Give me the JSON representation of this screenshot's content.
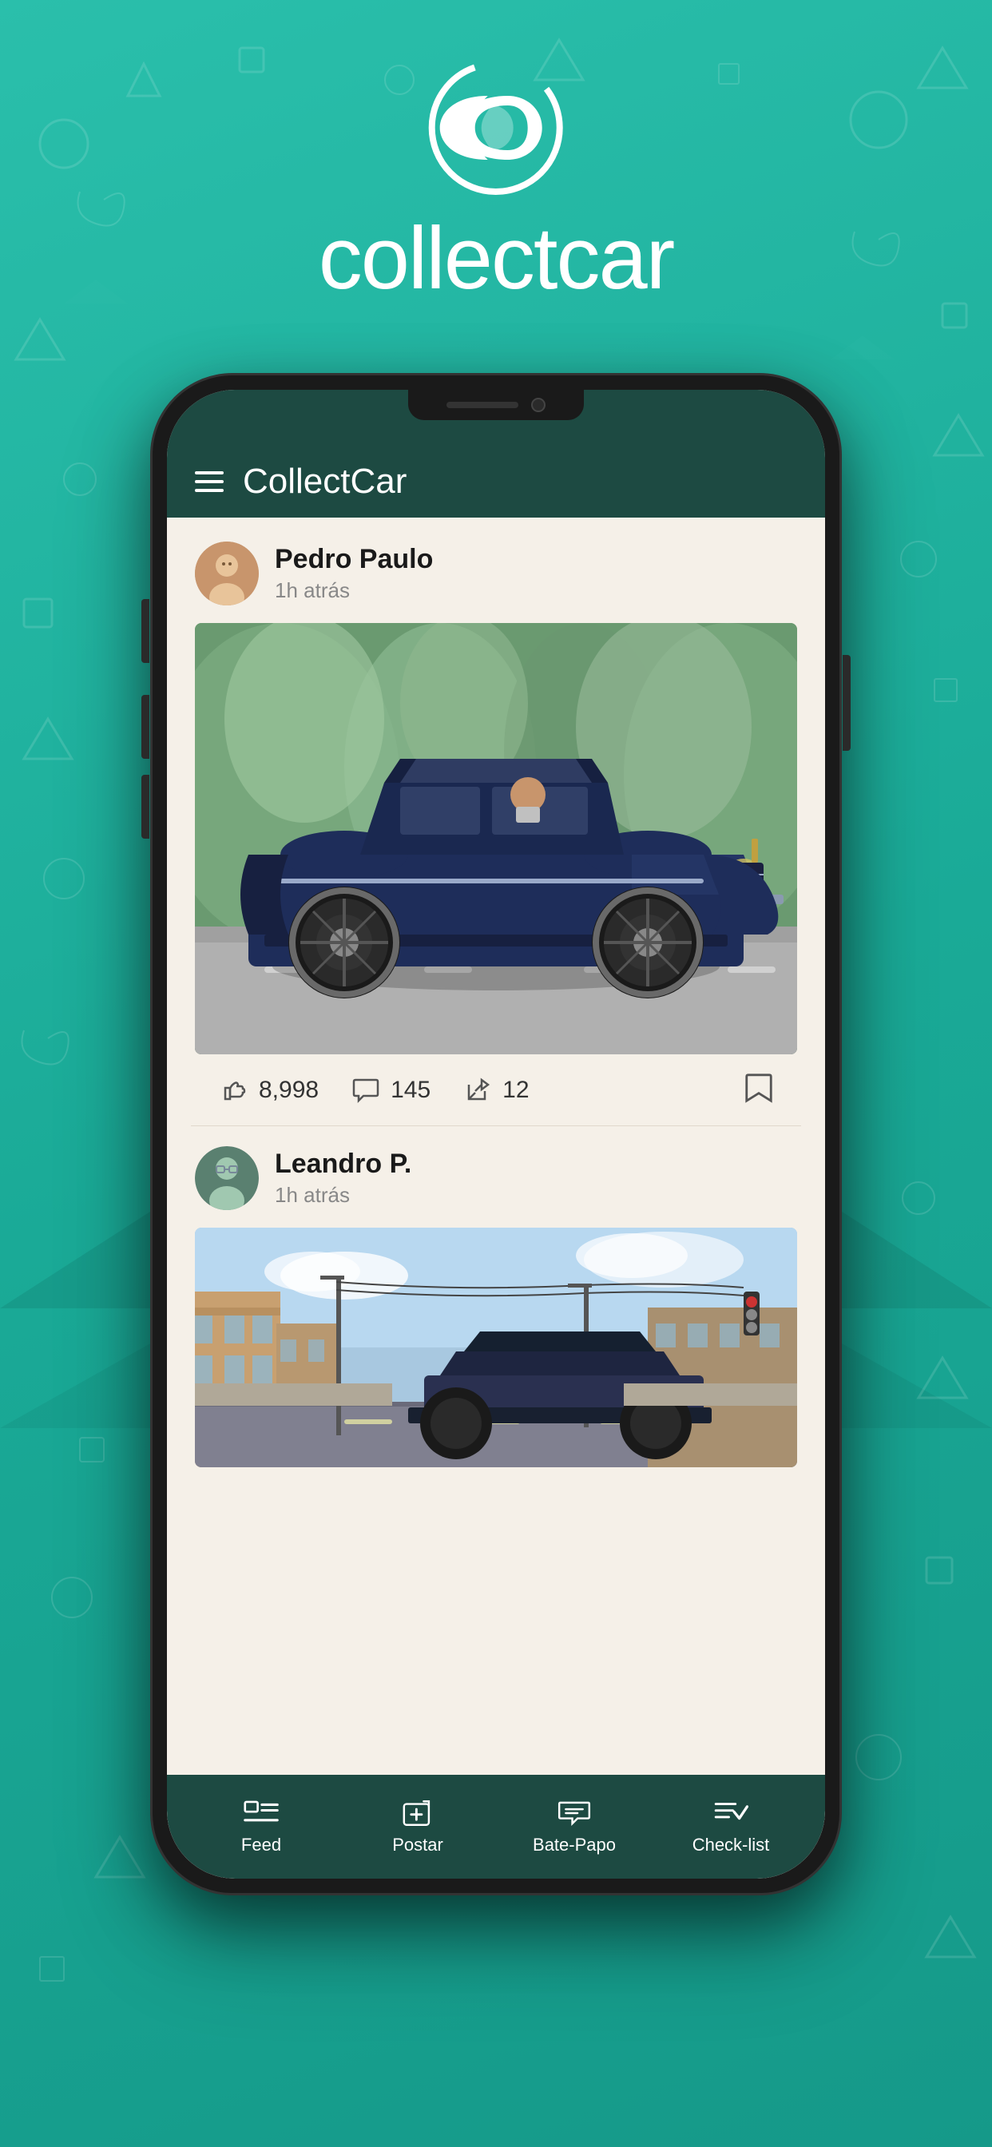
{
  "app": {
    "name": "collectcar",
    "displayName": "CollectCar"
  },
  "logo": {
    "text": "collectcar"
  },
  "header": {
    "title": "CollectCar",
    "menu_label": "Menu"
  },
  "posts": [
    {
      "author": "Pedro Paulo",
      "time": "1h atrás",
      "likes": "8,998",
      "comments": "145",
      "shares": "12"
    },
    {
      "author": "Leandro P.",
      "time": "1h atrás"
    }
  ],
  "nav": {
    "items": [
      {
        "label": "Feed",
        "icon": "feed-icon"
      },
      {
        "label": "Postar",
        "icon": "post-icon"
      },
      {
        "label": "Bate-Papo",
        "icon": "chat-icon"
      },
      {
        "label": "Check-list",
        "icon": "checklist-icon"
      }
    ]
  }
}
